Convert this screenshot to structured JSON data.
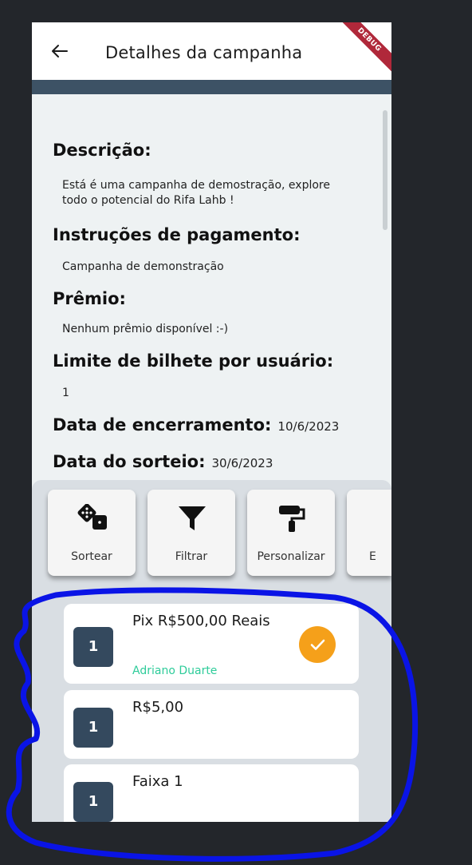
{
  "appbar": {
    "title": "Detalhes da campanha",
    "back_icon": "arrow-left-icon",
    "debug_banner": "DEBUG"
  },
  "details": {
    "descricao_label": "Descrição:",
    "descricao_text": "Está é uma campanha de demostração, explore todo o potencial do Rifa Lahb !",
    "instrucoes_label": "Instruções de pagamento:",
    "instrucoes_text": "Campanha de demonstração",
    "premio_label": "Prêmio:",
    "premio_text": "Nenhum prêmio disponível :-)",
    "limite_label": "Limite de bilhete por usuário:",
    "limite_value": "1",
    "encerramento_label": "Data de encerramento:",
    "encerramento_value": "10/6/2023",
    "sorteio_label": "Data do sorteio:",
    "sorteio_value": "30/6/2023"
  },
  "actions": [
    {
      "label": "Sortear",
      "icon": "dice-icon"
    },
    {
      "label": "Filtrar",
      "icon": "filter-icon"
    },
    {
      "label": "Personalizar",
      "icon": "paint-roller-icon"
    },
    {
      "label": "E",
      "icon": ""
    }
  ],
  "tickets": [
    {
      "number": "1",
      "name": "Pix R$500,00 Reais",
      "owner": "Adriano Duarte",
      "selected": true
    },
    {
      "number": "1",
      "name": "R$5,00",
      "owner": "",
      "selected": false
    },
    {
      "number": "1",
      "name": "Faixa 1",
      "owner": "",
      "selected": false
    }
  ],
  "colors": {
    "background": "#23262b",
    "badge": "#34495e",
    "check": "#f5a01a",
    "owner": "#2ecc9a",
    "annotation": "#0a14e6"
  }
}
